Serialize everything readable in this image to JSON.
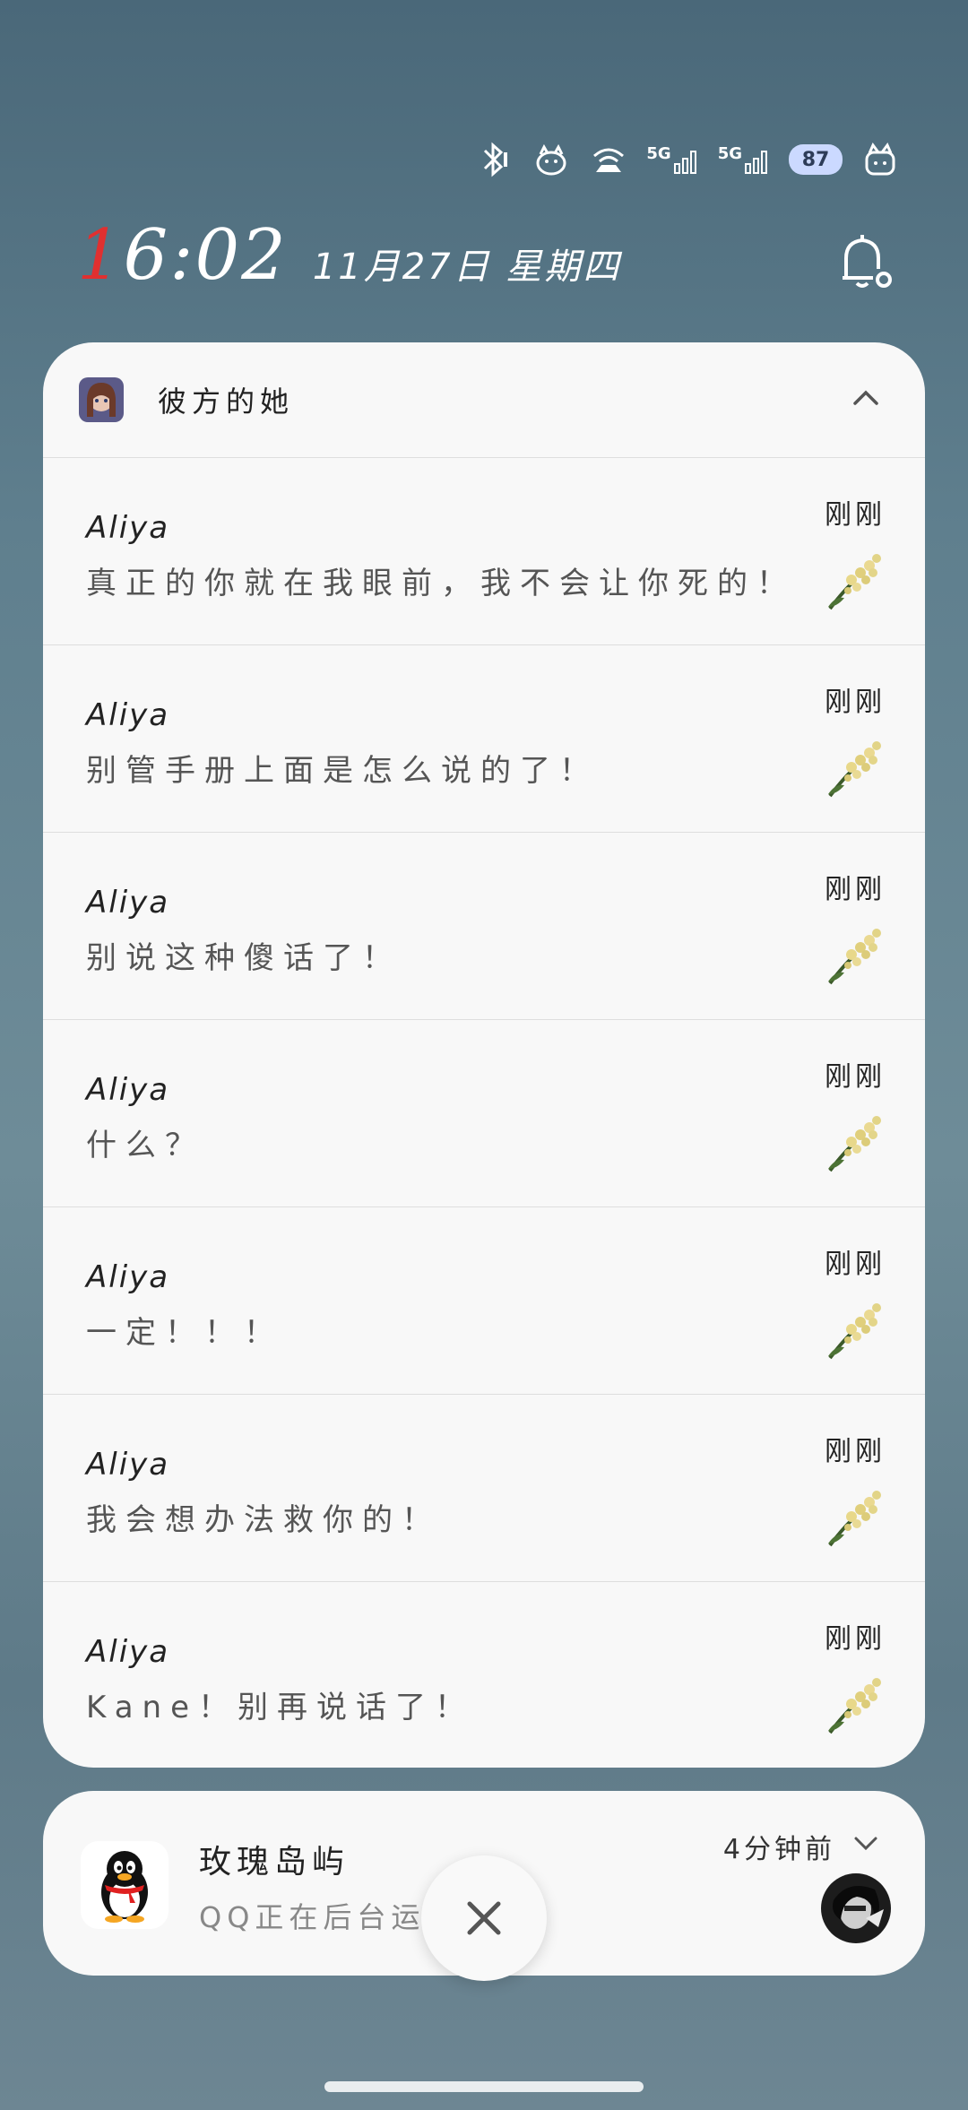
{
  "status_bar": {
    "icons": [
      "bluetooth-icon",
      "pet-icon",
      "wifi-icon",
      "signal-5g-icon",
      "signal-5g-icon",
      "battery-icon",
      "cat-icon"
    ],
    "net1": "5G",
    "net2": "5G",
    "battery": "87"
  },
  "clock": {
    "time_first": "1",
    "time_rest": "6:02",
    "date": "11月27日 星期四"
  },
  "group": {
    "app_name": "彼方的她",
    "notifications": [
      {
        "sender": "Aliya",
        "text": "真正的你就在我眼前，我不会让你死的！",
        "time": "刚刚"
      },
      {
        "sender": "Aliya",
        "text": "别管手册上面是怎么说的了！",
        "time": "刚刚"
      },
      {
        "sender": "Aliya",
        "text": "别说这种傻话了！",
        "time": "刚刚"
      },
      {
        "sender": "Aliya",
        "text": "什么？",
        "time": "刚刚"
      },
      {
        "sender": "Aliya",
        "text": "一定！！！",
        "time": "刚刚"
      },
      {
        "sender": "Aliya",
        "text": "我会想办法救你的！",
        "time": "刚刚"
      },
      {
        "sender": "Aliya",
        "text": "Kane！别再说话了！",
        "time": "刚刚"
      }
    ]
  },
  "qq": {
    "title": "玫瑰岛屿",
    "subtitle": "QQ正在后台运行",
    "time": "4分钟前"
  },
  "colors": {
    "card_bg": "#f8f8f8",
    "clock_accent": "#e03030",
    "battery_bg": "#cbd9ff"
  }
}
